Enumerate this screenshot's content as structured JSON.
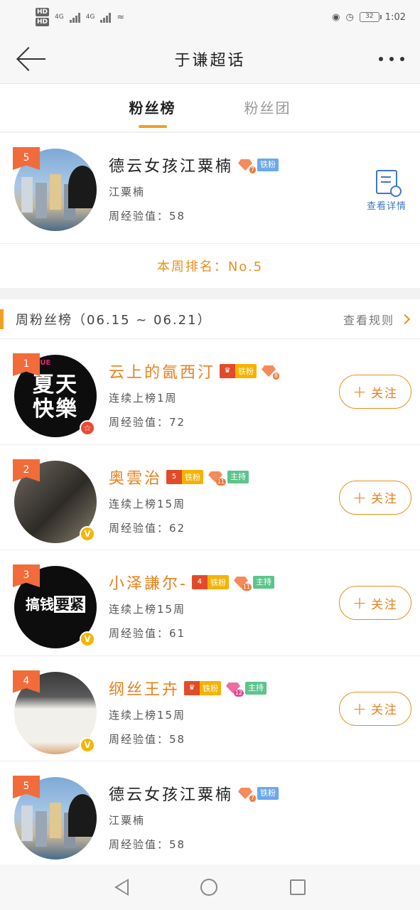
{
  "status_bar": {
    "time": "1:02",
    "battery": "32",
    "network_1": "4G",
    "network_2": "4G"
  },
  "header": {
    "title": "于谦超话"
  },
  "tabs": [
    {
      "label": "粉丝榜"
    },
    {
      "label": "粉丝团"
    }
  ],
  "my_card": {
    "rank": "5",
    "name": "德云女孩江粟楠",
    "gem_level": "7",
    "iron_badge": "铁粉",
    "alias": "江粟楠",
    "exp": "周经验值：58",
    "detail_label": "查看详情",
    "week_rank": "本周排名：No.5"
  },
  "weekly": {
    "title": "周粉丝榜（06.15 ~ 06.21）",
    "rules_label": "查看规则"
  },
  "poster": {
    "text_1": "夏天",
    "text_2": "快樂",
    "brand": "WUYUE",
    "tag_a": "搞钱",
    "tag_b": "要紧"
  },
  "follow_label": "关注",
  "ranking": [
    {
      "rank": "1",
      "name": "云上的氤西汀",
      "crown_level": "",
      "iron": "铁粉",
      "gem_level": "8",
      "host": "",
      "streak": "连续上榜1周",
      "exp": "周经验值：72"
    },
    {
      "rank": "2",
      "name": "奥雲治",
      "crown_level": "5",
      "iron": "铁粉",
      "gem_level": "11",
      "host": "主持",
      "streak": "连续上榜15周",
      "exp": "周经验值：62"
    },
    {
      "rank": "3",
      "name": "小泽謙尔-",
      "crown_level": "4",
      "iron": "铁粉",
      "gem_level": "11",
      "host": "主持",
      "streak": "连续上榜15周",
      "exp": "周经验值：61"
    },
    {
      "rank": "4",
      "name": "纲丝王卉",
      "crown_level": "",
      "iron": "铁粉",
      "gem_level": "12",
      "host": "主持",
      "streak": "连续上榜15周",
      "exp": "周经验值：58"
    },
    {
      "rank": "5",
      "name": "德云女孩江粟楠",
      "crown_level": "",
      "iron": "铁粉",
      "gem_level": "7",
      "host": "",
      "streak": "江粟楠",
      "exp": "周经验值：58"
    }
  ]
}
